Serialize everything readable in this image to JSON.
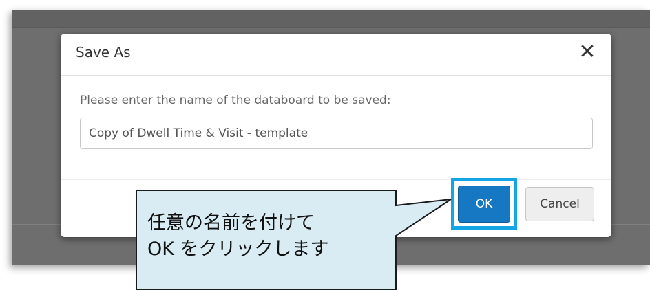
{
  "dialog": {
    "title": "Save As",
    "close_glyph": "✕",
    "prompt": "Please enter the name of the databoard to be saved:",
    "input_value": "Copy of Dwell Time & Visit - template",
    "ok_label": "OK",
    "cancel_label": "Cancel"
  },
  "callout": {
    "line1": "任意の名前を付けて",
    "line2": "OK をクリックします"
  },
  "colors": {
    "primary_button": "#1677c2",
    "highlight": "#14a6e4",
    "callout_fill": "#d9ecf3"
  }
}
